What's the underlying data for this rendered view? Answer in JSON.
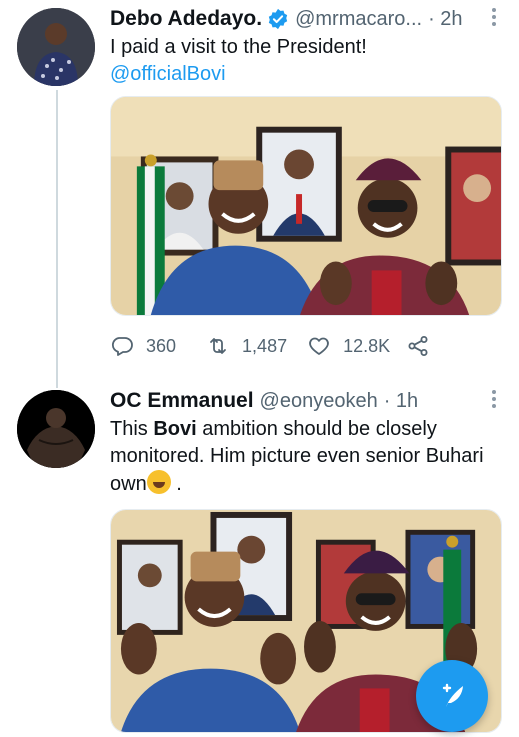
{
  "colors": {
    "accent": "#1d9bf0",
    "secondary_text": "#536471",
    "primary_text": "#0f1419",
    "thread_line": "#cfd9de"
  },
  "tweets": [
    {
      "display_name": "Debo Adedayo.",
      "verified": true,
      "handle": "@mrmacaro...",
      "time": "· 2h",
      "text_line1": "I paid a visit to the President!",
      "mention": "@officialBovi",
      "media_icon": "photo-two-men-in-office",
      "stats": {
        "replies": "360",
        "retweets": "1,487",
        "likes": "12.8K"
      },
      "icons": [
        "reply-icon",
        "retweet-icon",
        "like-icon",
        "share-icon"
      ]
    },
    {
      "display_name": "OC Emmanuel",
      "verified": false,
      "handle": "@eonyeokeh",
      "time": "· 1h",
      "text_pre": "This ",
      "text_bold": "Bovi",
      "text_post": " ambition should be closely monitored. Him picture even senior Buhari own",
      "text_end": ".",
      "media_icon": "photo-two-men-four-fingers"
    }
  ],
  "compose_button": {
    "icon": "feather-plus-icon"
  }
}
